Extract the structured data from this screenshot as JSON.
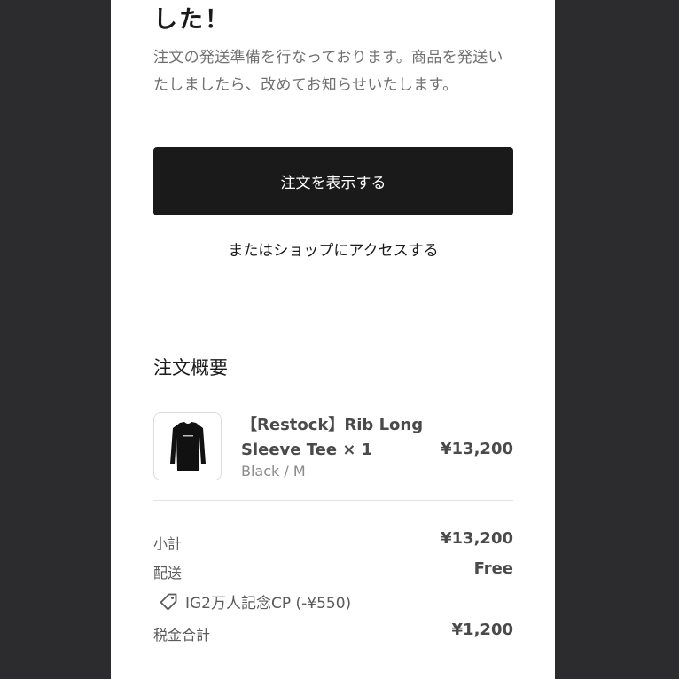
{
  "header": {
    "title_tail": "した！"
  },
  "message": {
    "description": "注文の発送準備を行なっております。商品を発送いたしましたら、改めてお知らせいたします。"
  },
  "actions": {
    "view_order_label": "注文を表示する",
    "shop_link_label": "またはショップにアクセスする"
  },
  "summary": {
    "heading": "注文概要",
    "item": {
      "name": "【Restock】Rib Long Sleeve Tee × 1",
      "variant": "Black / M",
      "price": "¥13,200",
      "image_icon": "long-sleeve-tee-icon"
    },
    "subtotal_label": "小計",
    "subtotal_value": "¥13,200",
    "shipping_label": "配送",
    "shipping_value": "Free",
    "discount_icon": "tag-icon",
    "discount_text": "IG2万人記念CP (-¥550)",
    "tax_label": "税金合計",
    "tax_value": "¥1,200"
  },
  "colors": {
    "background": "#2c2c2e",
    "page": "#ffffff",
    "button": "#1a1a1a",
    "muted_text": "#707070"
  }
}
